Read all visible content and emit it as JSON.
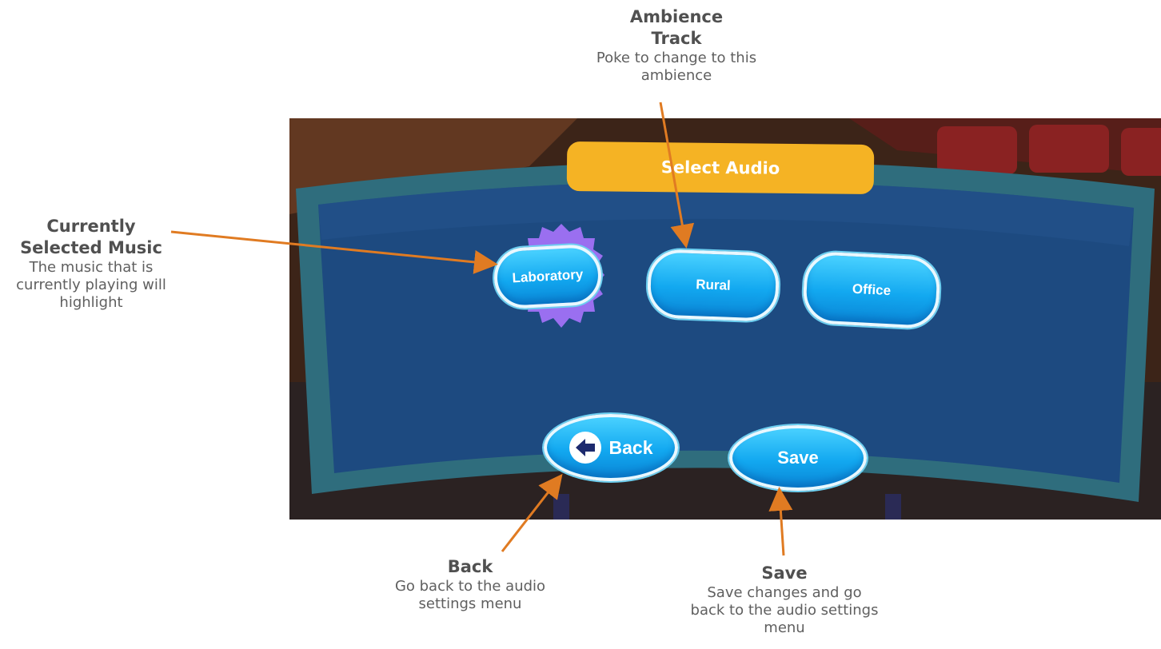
{
  "panel": {
    "title": "Select Audio",
    "tracks": [
      {
        "label": "Laboratory",
        "selected": true
      },
      {
        "label": "Rural",
        "selected": false
      },
      {
        "label": "Office",
        "selected": false
      }
    ],
    "back_label": "Back",
    "save_label": "Save"
  },
  "annotations": {
    "ambience": {
      "title": "Ambience Track",
      "desc": "Poke to change to this ambience"
    },
    "selected": {
      "title": "Currently Selected Music",
      "desc": "The music that is currently playing will highlight"
    },
    "back": {
      "title": "Back",
      "desc": "Go back to the audio settings menu"
    },
    "save": {
      "title": "Save",
      "desc": "Save changes and go back to the audio settings menu"
    }
  },
  "colors": {
    "arrow": "#e07b22",
    "title_bar": "#f5b324",
    "button": "#12a8f0",
    "highlight": "#9a6ff0",
    "panel": "#1e4f86"
  },
  "icons": {
    "back": "left-arrow-icon"
  }
}
